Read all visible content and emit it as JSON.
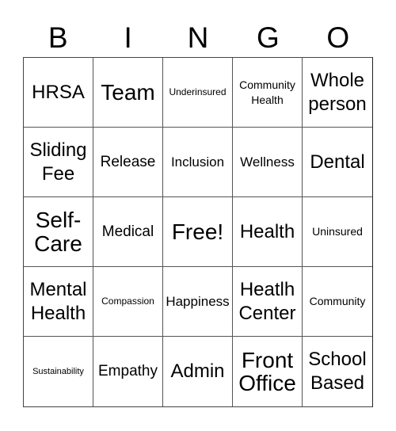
{
  "header": {
    "letters": [
      "B",
      "I",
      "N",
      "G",
      "O"
    ]
  },
  "grid": {
    "rows": [
      [
        "HRSA",
        "Team",
        "Underinsured",
        "Community Health",
        "Whole person"
      ],
      [
        "Sliding Fee",
        "Release",
        "Inclusion",
        "Wellness",
        "Dental"
      ],
      [
        "Self-Care",
        "Medical",
        "Free!",
        "Health",
        "Uninsured"
      ],
      [
        "Mental Health",
        "Compassion",
        "Happiness",
        "Heatlh Center",
        "Community"
      ],
      [
        "Sustainability",
        "Empathy",
        "Admin",
        "Front Office",
        "School Based"
      ]
    ]
  }
}
